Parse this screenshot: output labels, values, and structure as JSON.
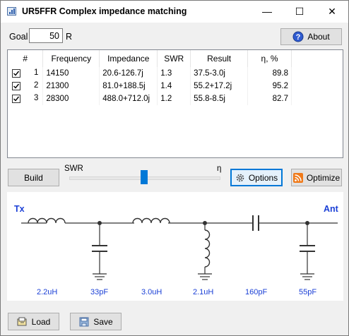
{
  "window": {
    "title": "UR5FFR Complex impedance matching",
    "controls": {
      "minimize": "—",
      "maximize": "☐",
      "close": "✕"
    }
  },
  "goal": {
    "label": "Goal",
    "value": "50",
    "unit": "R"
  },
  "about_button": "About",
  "table": {
    "headers": [
      "#",
      "Frequency",
      "Impedance",
      "SWR",
      "Result",
      "η, %"
    ],
    "rows": [
      {
        "checked": true,
        "index": "1",
        "frequency": "14150",
        "impedance": "20.6-126.7j",
        "swr": "1.3",
        "result": "37.5-3.0j",
        "eta": "89.8"
      },
      {
        "checked": true,
        "index": "2",
        "frequency": "21300",
        "impedance": "81.0+188.5j",
        "swr": "1.4",
        "result": "55.2+17.2j",
        "eta": "95.2"
      },
      {
        "checked": true,
        "index": "3",
        "frequency": "28300",
        "impedance": "488.0+712.0j",
        "swr": "1.2",
        "result": "55.8-8.5j",
        "eta": "82.7"
      }
    ]
  },
  "controls": {
    "build": "Build",
    "slider_left": "SWR",
    "slider_right": "η",
    "slider_position": 0.5,
    "options": "Options",
    "optimize": "Optimize"
  },
  "circuit": {
    "left_label": "Tx",
    "right_label": "Ant",
    "components": [
      {
        "type": "series-inductor",
        "value": "2.2uH"
      },
      {
        "type": "shunt-capacitor",
        "value": "33pF"
      },
      {
        "type": "series-inductor",
        "value": "3.0uH"
      },
      {
        "type": "shunt-inductor",
        "value": "2.1uH"
      },
      {
        "type": "series-capacitor",
        "value": "160pF"
      },
      {
        "type": "shunt-capacitor",
        "value": "55pF"
      }
    ]
  },
  "footer": {
    "load": "Load",
    "save": "Save"
  },
  "colors": {
    "accent": "#0078d7",
    "label_blue": "#1a3fd6"
  }
}
